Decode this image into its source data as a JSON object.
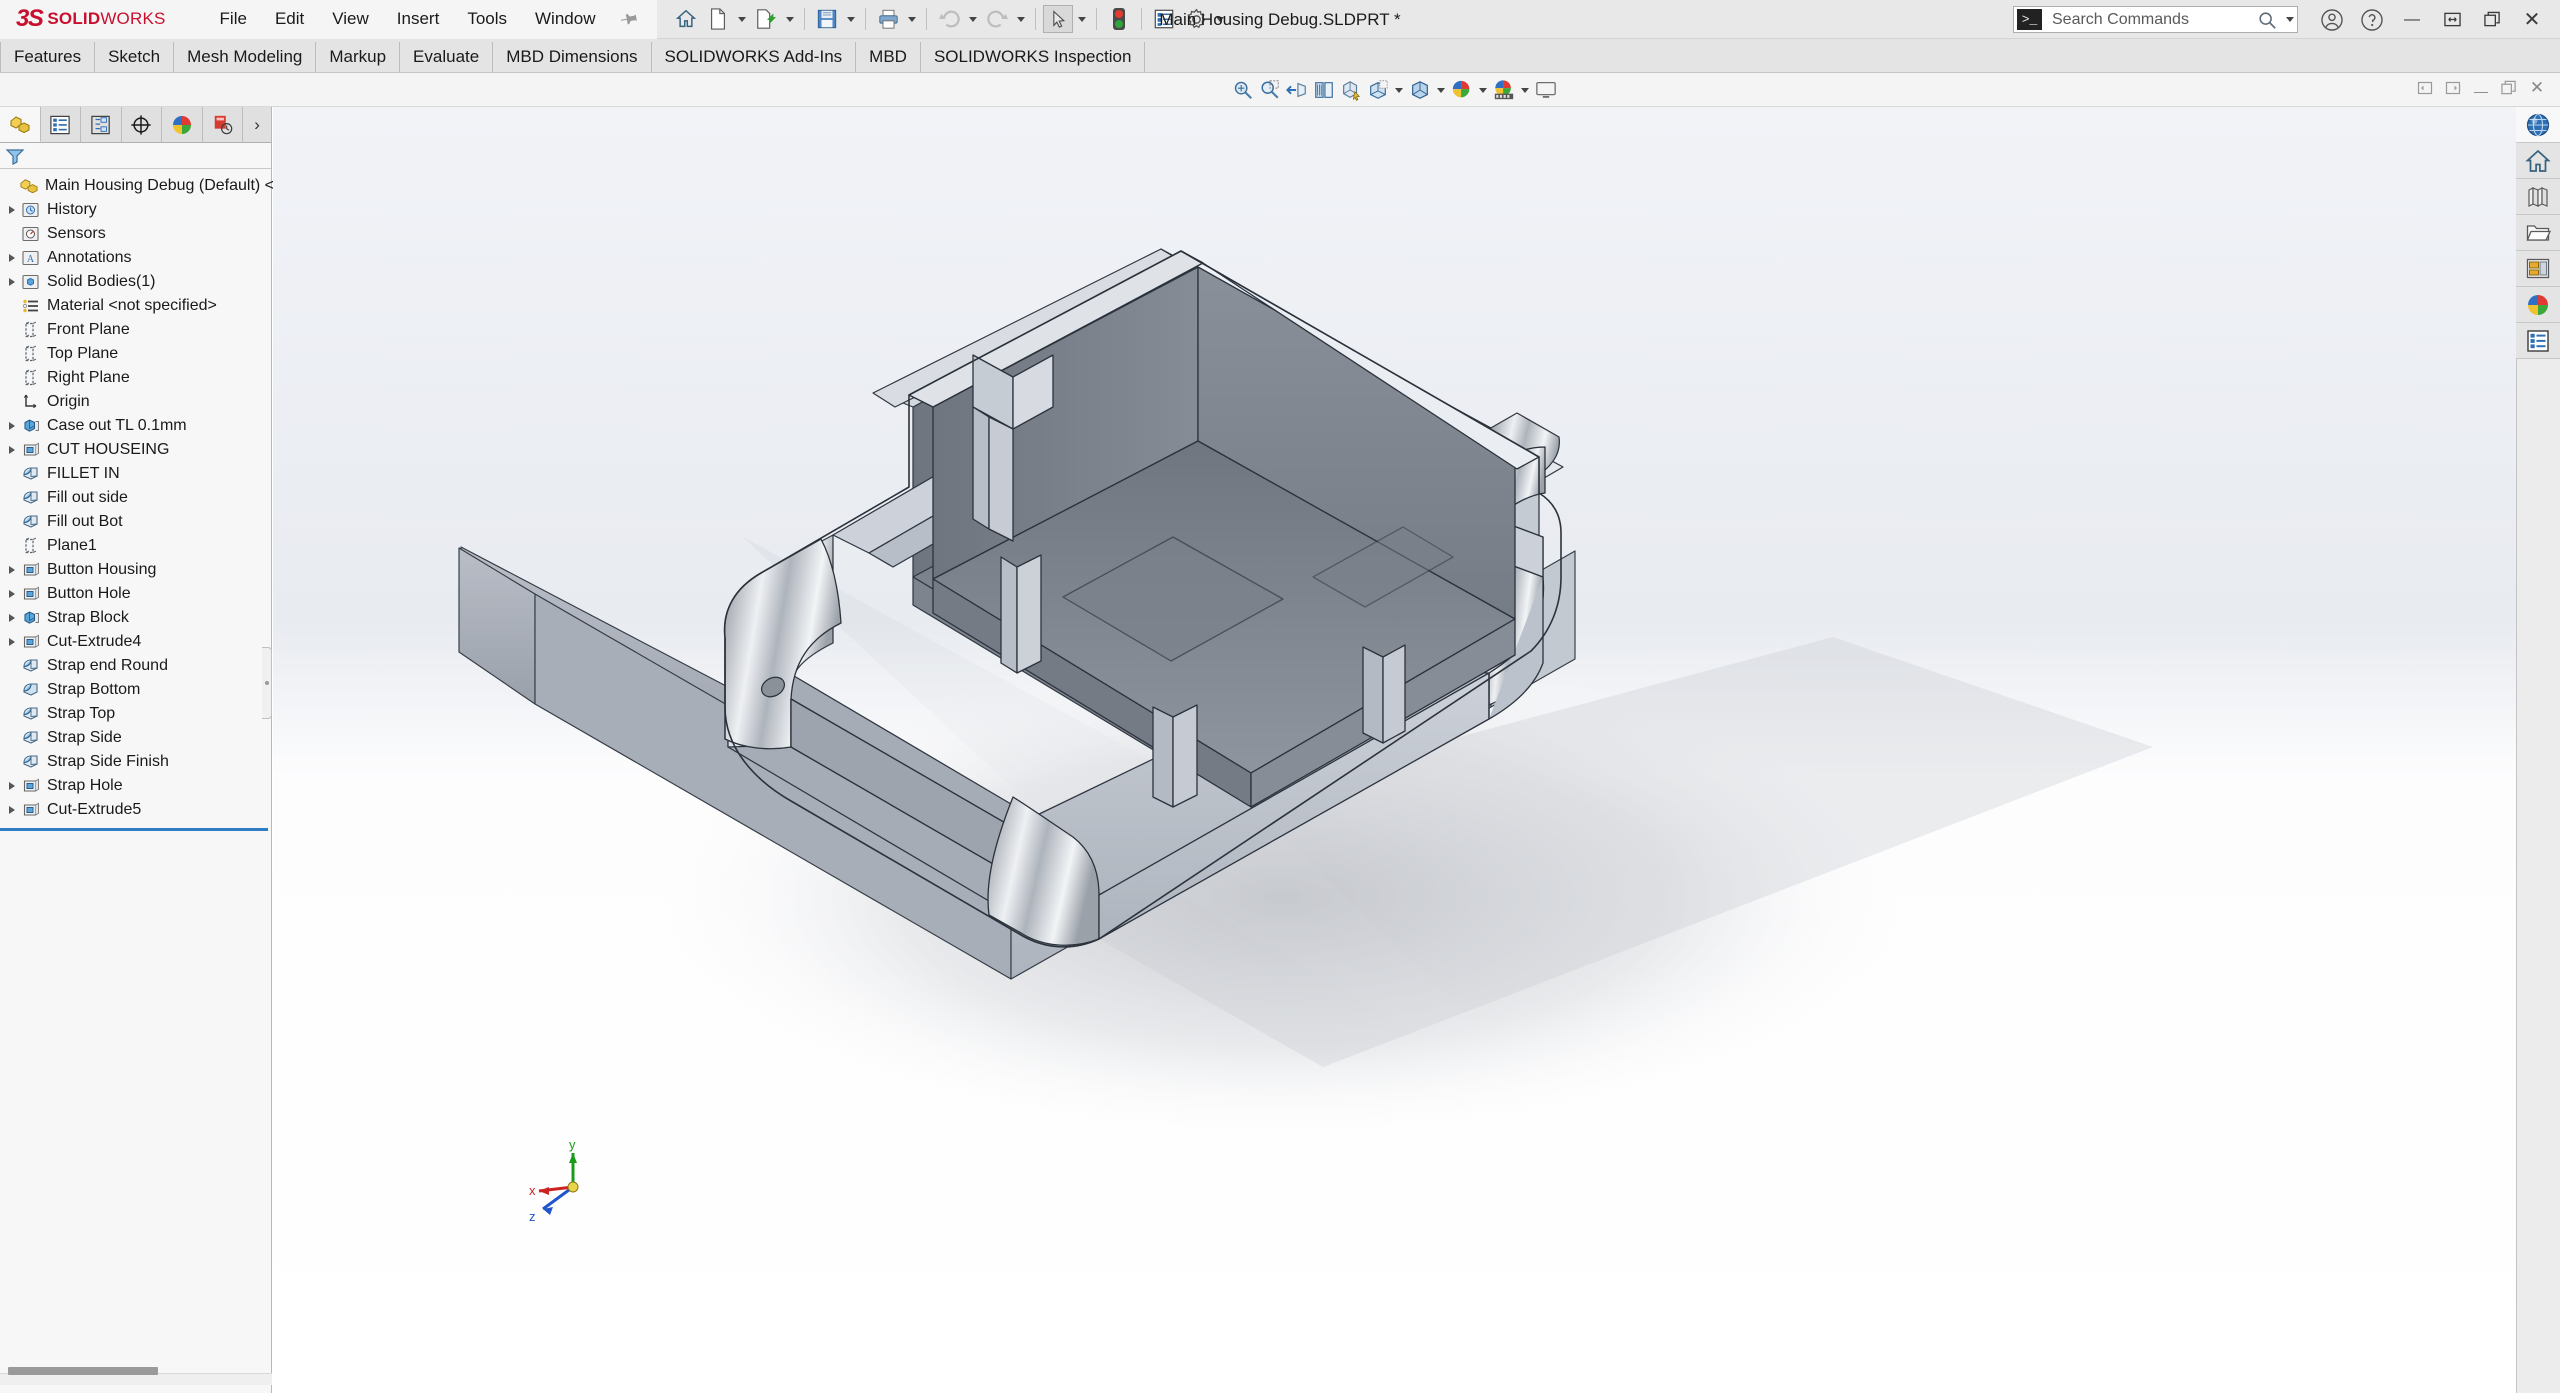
{
  "app": {
    "brand_3ds": "3S",
    "brand_solid": "SOLID",
    "brand_works": "WORKS",
    "accent_color": "#c8102e",
    "title": "Main Housing  Debug.SLDPRT *"
  },
  "menubar": {
    "items": [
      {
        "label": "File"
      },
      {
        "label": "Edit"
      },
      {
        "label": "View"
      },
      {
        "label": "Insert"
      },
      {
        "label": "Tools"
      },
      {
        "label": "Window"
      }
    ],
    "pin_icon": "pushpin-icon"
  },
  "quick_access": {
    "items": [
      {
        "name": "home-icon",
        "label": "Home",
        "caret": false
      },
      {
        "name": "new-document-icon",
        "label": "New",
        "caret": true
      },
      {
        "name": "open-document-icon",
        "label": "Open",
        "caret": true
      },
      {
        "name": "save-icon",
        "label": "Save",
        "caret": true
      },
      {
        "name": "print-icon",
        "label": "Print",
        "caret": true
      },
      {
        "name": "undo-icon",
        "label": "Undo",
        "caret": true
      },
      {
        "name": "redo-icon",
        "label": "Redo",
        "caret": true
      },
      {
        "name": "select-cursor-icon",
        "label": "Select",
        "caret": true
      },
      {
        "name": "rebuild-traffic-light-icon",
        "label": "Rebuild",
        "caret": false
      },
      {
        "name": "file-properties-icon",
        "label": "File Properties",
        "caret": false
      },
      {
        "name": "options-gear-icon",
        "label": "Options",
        "caret": true
      }
    ]
  },
  "window_controls": {
    "search": {
      "placeholder": "Search Commands",
      "value": "",
      "prompt_glyph": ">_",
      "search_icon": "magnifier-icon",
      "dropdown_icon": "chevron-down-icon"
    },
    "account_icon": "user-account-icon",
    "help_icon": "help-question-icon",
    "minimize_label": "—",
    "restore_label": "⫠",
    "maximize_label": "❐",
    "close_label": "✕"
  },
  "ribbon": {
    "tabs": [
      {
        "label": "Features",
        "active": false
      },
      {
        "label": "Sketch",
        "active": false
      },
      {
        "label": "Mesh Modeling",
        "active": false
      },
      {
        "label": "Markup",
        "active": false
      },
      {
        "label": "Evaluate",
        "active": false
      },
      {
        "label": "MBD Dimensions",
        "active": false
      },
      {
        "label": "SOLIDWORKS Add-Ins",
        "active": false
      },
      {
        "label": "MBD",
        "active": false
      },
      {
        "label": "SOLIDWORKS Inspection",
        "active": false
      }
    ]
  },
  "view_toolbar": {
    "items": [
      {
        "name": "zoom-to-fit-icon",
        "label": "Zoom to Fit",
        "caret": false
      },
      {
        "name": "zoom-to-area-icon",
        "label": "Zoom to Area",
        "caret": false
      },
      {
        "name": "previous-view-icon",
        "label": "Previous View",
        "caret": false
      },
      {
        "name": "section-view-icon",
        "label": "Section View",
        "caret": false
      },
      {
        "name": "view-orientation-icon",
        "label": "View Orientation",
        "caret": false
      },
      {
        "name": "display-style-icon",
        "label": "Display Style",
        "caret": true
      },
      {
        "name": "hide-show-items-icon",
        "label": "Hide/Show Items",
        "caret": true
      },
      {
        "name": "edit-appearance-icon",
        "label": "Edit Appearance",
        "caret": true
      },
      {
        "name": "apply-scene-icon",
        "label": "Apply Scene",
        "caret": true
      },
      {
        "name": "view-settings-icon",
        "label": "View Settings",
        "caret": true
      },
      {
        "name": "display-monitor-icon",
        "label": "Viewport",
        "caret": false
      }
    ]
  },
  "document_window_controls": {
    "restore_left_label": "◁",
    "restore_right_label": "▷",
    "minimize_label": "—",
    "restore_label": "❐",
    "close_label": "✕"
  },
  "left_panel": {
    "tabs": [
      {
        "name": "feature-manager-tab",
        "label": "FeatureManager design tree",
        "active": true
      },
      {
        "name": "property-manager-tab",
        "label": "PropertyManager",
        "active": false
      },
      {
        "name": "configuration-manager-tab",
        "label": "ConfigurationManager",
        "active": false
      },
      {
        "name": "dimxpert-manager-tab",
        "label": "DimXpertManager",
        "active": false
      },
      {
        "name": "display-manager-tab",
        "label": "DisplayManager",
        "active": false
      },
      {
        "name": "render-tools-tab",
        "label": "Render Tools",
        "active": false
      }
    ],
    "expand_chevron": "›",
    "filter_icon": "filter-funnel-icon",
    "tree": [
      {
        "label": "Main Housing  Debug (Default) <<D",
        "icon": "part-document-icon",
        "indent": 0,
        "expandable": false,
        "root": true
      },
      {
        "label": "History",
        "icon": "history-folder-icon",
        "indent": 1,
        "expandable": true
      },
      {
        "label": "Sensors",
        "icon": "sensors-folder-icon",
        "indent": 1,
        "expandable": false
      },
      {
        "label": "Annotations",
        "icon": "annotations-folder-icon",
        "indent": 1,
        "expandable": true
      },
      {
        "label": "Solid Bodies(1)",
        "icon": "solid-bodies-folder-icon",
        "indent": 1,
        "expandable": true
      },
      {
        "label": "Material <not specified>",
        "icon": "material-icon",
        "indent": 1,
        "expandable": false
      },
      {
        "label": "Front Plane",
        "icon": "plane-icon",
        "indent": 1,
        "expandable": false
      },
      {
        "label": "Top Plane",
        "icon": "plane-icon",
        "indent": 1,
        "expandable": false
      },
      {
        "label": "Right Plane",
        "icon": "plane-icon",
        "indent": 1,
        "expandable": false
      },
      {
        "label": "Origin",
        "icon": "origin-icon",
        "indent": 1,
        "expandable": false
      },
      {
        "label": "Case out TL 0.1mm",
        "icon": "boss-extrude-icon",
        "indent": 1,
        "expandable": true
      },
      {
        "label": "CUT HOUSEING",
        "icon": "cut-extrude-icon",
        "indent": 1,
        "expandable": true
      },
      {
        "label": "FILLET IN",
        "icon": "fillet-icon",
        "indent": 1,
        "expandable": false
      },
      {
        "label": "Fill out side",
        "icon": "fillet-icon",
        "indent": 1,
        "expandable": false
      },
      {
        "label": "Fill out Bot",
        "icon": "fillet-icon",
        "indent": 1,
        "expandable": false
      },
      {
        "label": "Plane1",
        "icon": "plane-icon",
        "indent": 1,
        "expandable": false
      },
      {
        "label": "Button Housing",
        "icon": "cut-extrude-icon",
        "indent": 1,
        "expandable": true
      },
      {
        "label": "Button Hole",
        "icon": "cut-extrude-icon",
        "indent": 1,
        "expandable": true
      },
      {
        "label": "Strap Block",
        "icon": "boss-extrude-icon",
        "indent": 1,
        "expandable": true
      },
      {
        "label": "Cut-Extrude4",
        "icon": "cut-extrude-icon",
        "indent": 1,
        "expandable": true
      },
      {
        "label": "Strap end Round",
        "icon": "fillet-icon",
        "indent": 1,
        "expandable": false
      },
      {
        "label": "Strap Bottom",
        "icon": "fillet-icon",
        "indent": 1,
        "expandable": false
      },
      {
        "label": "Strap Top",
        "icon": "fillet-icon",
        "indent": 1,
        "expandable": false
      },
      {
        "label": "Strap Side",
        "icon": "fillet-icon",
        "indent": 1,
        "expandable": false
      },
      {
        "label": "Strap Side Finish",
        "icon": "fillet-icon",
        "indent": 1,
        "expandable": false
      },
      {
        "label": "Strap Hole",
        "icon": "cut-extrude-icon",
        "indent": 1,
        "expandable": true
      },
      {
        "label": "Cut-Extrude5",
        "icon": "cut-extrude-icon",
        "indent": 1,
        "expandable": true
      }
    ],
    "rollback_bar_color": "#2e7cc4"
  },
  "graphics": {
    "model_name": "Main Housing Debug",
    "model_description": "Isometric shaded-with-edges view of a rectangular enclosure / housing shell with open top cavity, rounded corners, strap lugs and button cutouts",
    "background_top_color": "#eef1f5",
    "background_bottom_color": "#ffffff",
    "model_face_color": "#9aa1ab",
    "model_light_color": "#c3c9d2",
    "model_dark_color": "#6f7680",
    "triad": {
      "x_label": "x",
      "y_label": "y",
      "z_label": "z",
      "x_color": "#cc2222",
      "y_color": "#1a9a1a",
      "z_color": "#2255cc"
    }
  },
  "task_pane": {
    "items": [
      {
        "name": "solidworks-resources-icon",
        "label": "SOLIDWORKS Resources",
        "active": true
      },
      {
        "name": "design-library-icon",
        "label": "Design Library",
        "active": false
      },
      {
        "name": "file-explorer-books-icon",
        "label": "File Explorer",
        "active": false
      },
      {
        "name": "open-folder-icon",
        "label": "Open Folder",
        "active": false
      },
      {
        "name": "view-palette-icon",
        "label": "View Palette",
        "active": false
      },
      {
        "name": "appearances-scenes-icon",
        "label": "Appearances, Scenes and Decals",
        "active": false
      },
      {
        "name": "custom-properties-icon",
        "label": "Custom Properties",
        "active": false
      }
    ]
  }
}
